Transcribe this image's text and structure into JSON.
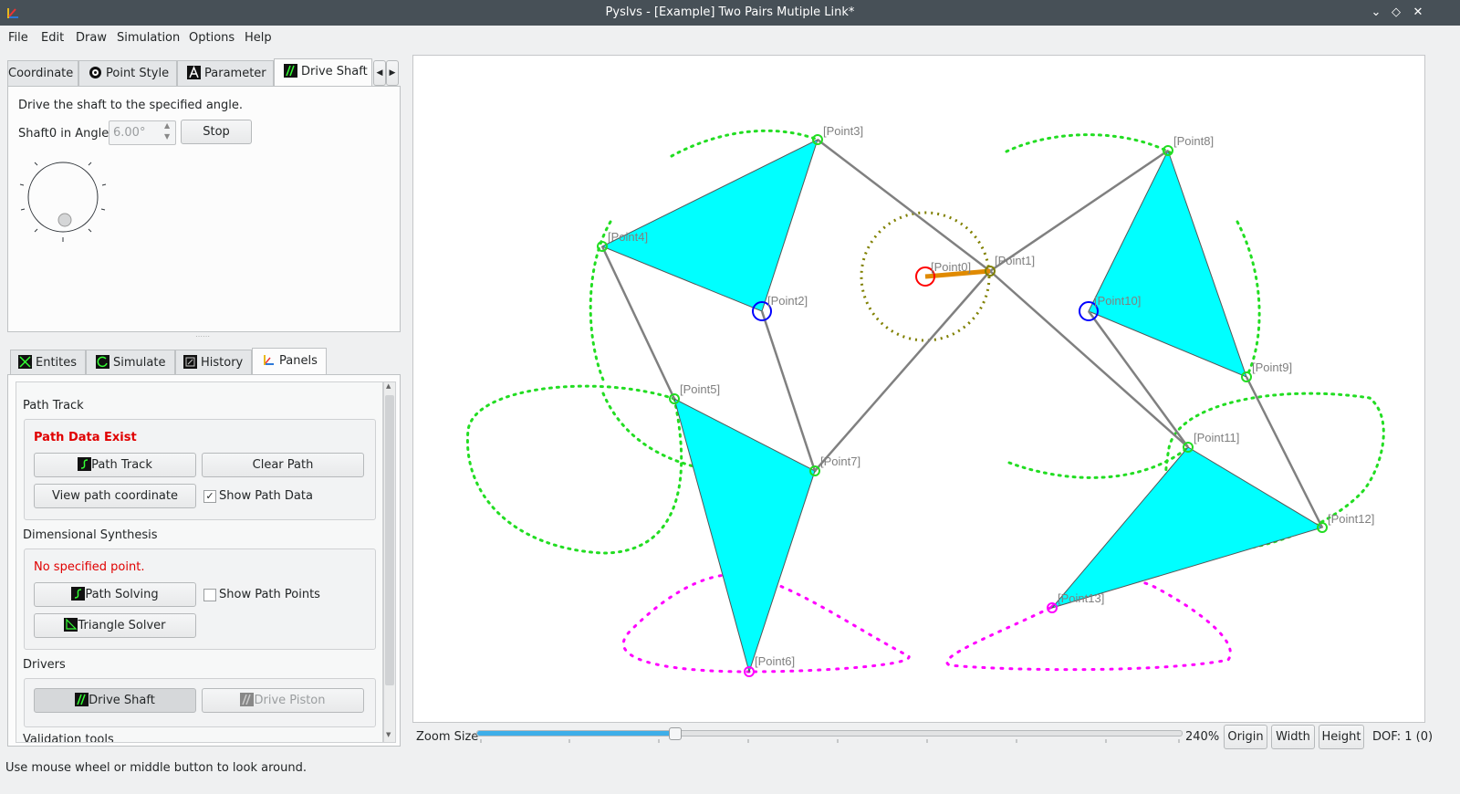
{
  "window": {
    "title": "Pyslvs - [Example] Two Pairs Mutiple Link*"
  },
  "menu": [
    "File",
    "Edit",
    "Draw",
    "Simulation",
    "Options",
    "Help"
  ],
  "top_tabs": {
    "coordinate": "Coordinate",
    "point_style": "Point Style",
    "parameter": "Parameter",
    "drive_shaft": "Drive Shaft"
  },
  "drive_shaft": {
    "description": "Drive the shaft to the specified angle.",
    "angle_label": "Shaft0 in Angle:",
    "angle_value": "6.00°",
    "stop_label": "Stop"
  },
  "bottom_tabs": {
    "entities": "Entites",
    "simulate": "Simulate",
    "history": "History",
    "panels": "Panels"
  },
  "panels": {
    "path_track_title": "Path Track",
    "path_data_status": "Path Data Exist",
    "path_track_btn": "Path Track",
    "clear_path_btn": "Clear Path",
    "view_path_btn": "View path coordinate",
    "show_path_data": "Show Path Data",
    "dim_synth_title": "Dimensional Synthesis",
    "no_point_status": "No specified point.",
    "path_solving_btn": "Path Solving",
    "show_path_points": "Show Path Points",
    "triangle_solver_btn": "Triangle Solver",
    "drivers_title": "Drivers",
    "drive_shaft_btn": "Drive Shaft",
    "drive_piston_btn": "Drive Piston",
    "validation_title": "Validation tools"
  },
  "canvas": {
    "points": [
      {
        "id": "p0",
        "label": "[Point0]",
        "color": "#ff0000"
      },
      {
        "id": "p1",
        "label": "[Point1]",
        "color": "#808000"
      },
      {
        "id": "p2",
        "label": "[Point2]",
        "color": "#0000ff"
      },
      {
        "id": "p3",
        "label": "[Point3]",
        "color": "#22dd22"
      },
      {
        "id": "p4",
        "label": "[Point4]",
        "color": "#22dd22"
      },
      {
        "id": "p5",
        "label": "[Point5]",
        "color": "#22dd22"
      },
      {
        "id": "p6",
        "label": "[Point6]",
        "color": "#ff00ff"
      },
      {
        "id": "p7",
        "label": "[Point7]",
        "color": "#22dd22"
      },
      {
        "id": "p8",
        "label": "[Point8]",
        "color": "#22dd22"
      },
      {
        "id": "p9",
        "label": "[Point9]",
        "color": "#22dd22"
      },
      {
        "id": "p10",
        "label": "[Point10]",
        "color": "#0000ff"
      },
      {
        "id": "p11",
        "label": "[Point11]",
        "color": "#22dd22"
      },
      {
        "id": "p12",
        "label": "[Point12]",
        "color": "#22dd22"
      },
      {
        "id": "p13",
        "label": "[Point13]",
        "color": "#ff00ff"
      }
    ]
  },
  "zoom": {
    "label": "Zoom Size",
    "value": "240%",
    "fraction": 0.28,
    "origin_btn": "Origin",
    "width_btn": "Width",
    "height_btn": "Height",
    "dof": "DOF: 1 (0)"
  },
  "status": {
    "text": "Use mouse wheel or middle button to look around."
  },
  "colors": {
    "link_fill": "#00ffff",
    "path_green": "#22dd22",
    "path_magenta": "#ff00ff",
    "crank": "#e08a00"
  }
}
